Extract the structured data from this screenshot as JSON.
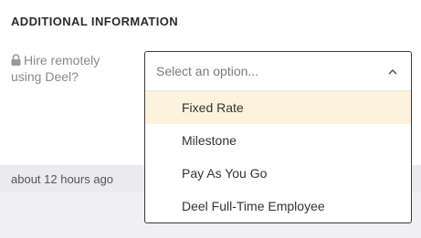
{
  "section": {
    "title": "ADDITIONAL INFORMATION"
  },
  "field": {
    "label": "Hire remotely using Deel?"
  },
  "dropdown": {
    "placeholder": "Select an option...",
    "options": [
      {
        "label": "Fixed Rate",
        "highlighted": true
      },
      {
        "label": "Milestone",
        "highlighted": false
      },
      {
        "label": "Pay As You Go",
        "highlighted": false
      },
      {
        "label": "Deel Full-Time Employee",
        "highlighted": false
      }
    ]
  },
  "meta": {
    "timestamp": "about 12 hours ago"
  },
  "icons": {
    "lock": "lock-icon",
    "chevron": "chevron-up-icon"
  },
  "colors": {
    "highlight": "#fdf3dd",
    "border": "#3a3a3a"
  }
}
